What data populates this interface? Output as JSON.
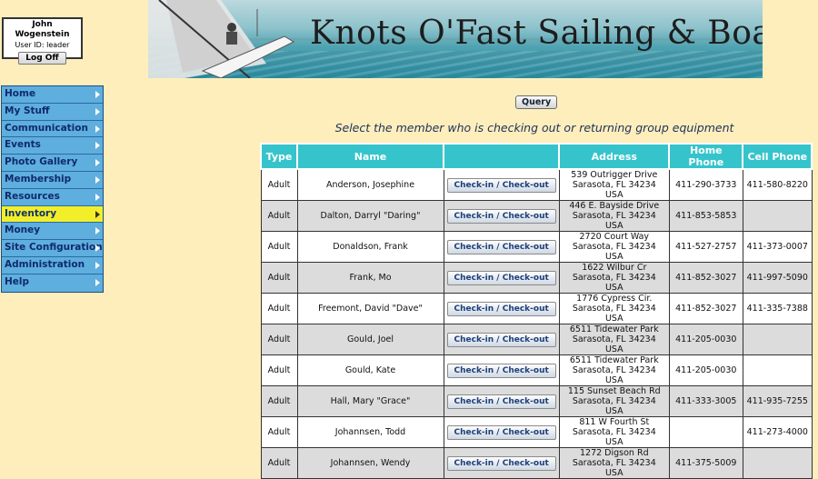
{
  "user": {
    "name": "John Wogenstein",
    "id_label": "User ID:",
    "id_value": "leader",
    "logoff_label": "Log Off"
  },
  "banner": {
    "title": "Knots O'Fast Sailing & Boating"
  },
  "menu": {
    "items": [
      {
        "label": "Home"
      },
      {
        "label": "My Stuff"
      },
      {
        "label": "Communication"
      },
      {
        "label": "Events"
      },
      {
        "label": "Photo Gallery"
      },
      {
        "label": "Membership"
      },
      {
        "label": "Resources"
      },
      {
        "label": "Inventory"
      },
      {
        "label": "Money"
      },
      {
        "label": "Site Configuration"
      },
      {
        "label": "Administration"
      },
      {
        "label": "Help"
      }
    ],
    "active": "Inventory"
  },
  "main": {
    "query_label": "Query",
    "instruction": "Select the member who is checking out or returning group equipment",
    "columns": {
      "type": "Type",
      "name": "Name",
      "action": "",
      "address": "Address",
      "home": "Home Phone",
      "cell": "Cell Phone"
    },
    "button_label": "Check-in / Check-out",
    "rows": [
      {
        "type": "Adult",
        "name": "Anderson, Josephine",
        "addr1": "539 Outrigger Drive",
        "addr2": "Sarasota, FL 34234 USA",
        "home": "411-290-3733",
        "cell": "411-580-8220"
      },
      {
        "type": "Adult",
        "name": "Dalton, Darryl \"Daring\"",
        "addr1": "446 E. Bayside Drive",
        "addr2": "Sarasota, FL 34234 USA",
        "home": "411-853-5853",
        "cell": ""
      },
      {
        "type": "Adult",
        "name": "Donaldson, Frank",
        "addr1": "2720 Court Way",
        "addr2": "Sarasota, FL 34234 USA",
        "home": "411-527-2757",
        "cell": "411-373-0007"
      },
      {
        "type": "Adult",
        "name": "Frank, Mo",
        "addr1": "1622 Wilbur Cr",
        "addr2": "Sarasota, FL 34234 USA",
        "home": "411-852-3027",
        "cell": "411-997-5090"
      },
      {
        "type": "Adult",
        "name": "Freemont, David \"Dave\"",
        "addr1": "1776 Cypress Cir.",
        "addr2": "Sarasota, FL 34234 USA",
        "home": "411-852-3027",
        "cell": "411-335-7388"
      },
      {
        "type": "Adult",
        "name": "Gould, Joel",
        "addr1": "6511 Tidewater Park",
        "addr2": "Sarasota, FL 34234 USA",
        "home": "411-205-0030",
        "cell": ""
      },
      {
        "type": "Adult",
        "name": "Gould, Kate",
        "addr1": "6511 Tidewater Park",
        "addr2": "Sarasota, FL 34234 USA",
        "home": "411-205-0030",
        "cell": ""
      },
      {
        "type": "Adult",
        "name": "Hall, Mary \"Grace\"",
        "addr1": "115 Sunset Beach Rd",
        "addr2": "Sarasota, FL 34234 USA",
        "home": "411-333-3005",
        "cell": "411-935-7255"
      },
      {
        "type": "Adult",
        "name": "Johannsen, Todd",
        "addr1": "811 W Fourth St",
        "addr2": "Sarasota, FL 34234 USA",
        "home": "",
        "cell": "411-273-4000"
      },
      {
        "type": "Adult",
        "name": "Johannsen, Wendy",
        "addr1": "1272 Digson Rd",
        "addr2": "Sarasota, FL 34234 USA",
        "home": "411-375-5009",
        "cell": ""
      }
    ]
  }
}
